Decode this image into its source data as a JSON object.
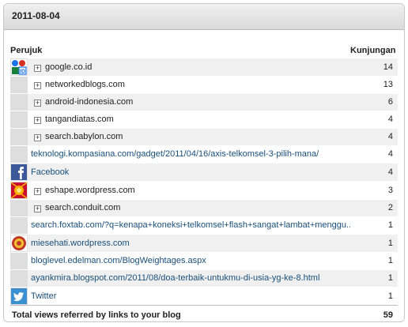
{
  "panel": {
    "date": "2011-08-04"
  },
  "table": {
    "col_referrer": "Perujuk",
    "col_views": "Kunjungan",
    "rows": [
      {
        "label": "google.co.id",
        "count": "14",
        "expandable": true,
        "link": false,
        "icon": "google-id-icon"
      },
      {
        "label": "networkedblogs.com",
        "count": "13",
        "expandable": true,
        "link": false,
        "icon": ""
      },
      {
        "label": "android-indonesia.com",
        "count": "6",
        "expandable": true,
        "link": false,
        "icon": ""
      },
      {
        "label": "tangandiatas.com",
        "count": "4",
        "expandable": true,
        "link": false,
        "icon": ""
      },
      {
        "label": "search.babylon.com",
        "count": "4",
        "expandable": true,
        "link": false,
        "icon": ""
      },
      {
        "label": "teknologi.kompasiana.com/gadget/2011/04/16/axis-telkomsel-3-pilih-mana/",
        "count": "4",
        "expandable": false,
        "link": true,
        "icon": ""
      },
      {
        "label": "Facebook",
        "count": "4",
        "expandable": false,
        "link": true,
        "icon": "facebook-icon"
      },
      {
        "label": "eshape.wordpress.com",
        "count": "3",
        "expandable": true,
        "link": false,
        "icon": "eshape-icon"
      },
      {
        "label": "search.conduit.com",
        "count": "2",
        "expandable": true,
        "link": false,
        "icon": ""
      },
      {
        "label": "search.foxtab.com/?q=kenapa+koneksi+telkomsel+flash+sangat+lambat+menggu...",
        "count": "1",
        "expandable": false,
        "link": true,
        "icon": ""
      },
      {
        "label": "miesehati.wordpress.com",
        "count": "1",
        "expandable": false,
        "link": true,
        "icon": "miesehati-icon"
      },
      {
        "label": "bloglevel.edelman.com/BlogWeightages.aspx",
        "count": "1",
        "expandable": false,
        "link": true,
        "icon": ""
      },
      {
        "label": "ayankmira.blogspot.com/2011/08/doa-terbaik-untukmu-di-usia-yg-ke-8.html",
        "count": "1",
        "expandable": false,
        "link": true,
        "icon": ""
      },
      {
        "label": "Twitter",
        "count": "1",
        "expandable": false,
        "link": true,
        "icon": "twitter-icon"
      }
    ],
    "total_label": "Total views referred by links to your blog",
    "total_count": "59"
  },
  "icon_texts": {
    "google_id": "ID"
  },
  "colors": {
    "link": "#1a4f7a",
    "alt_row": "#f0f0f0",
    "icon_col": "#dedede",
    "facebook": "#3b5998",
    "twitter": "#3a8fd0"
  }
}
